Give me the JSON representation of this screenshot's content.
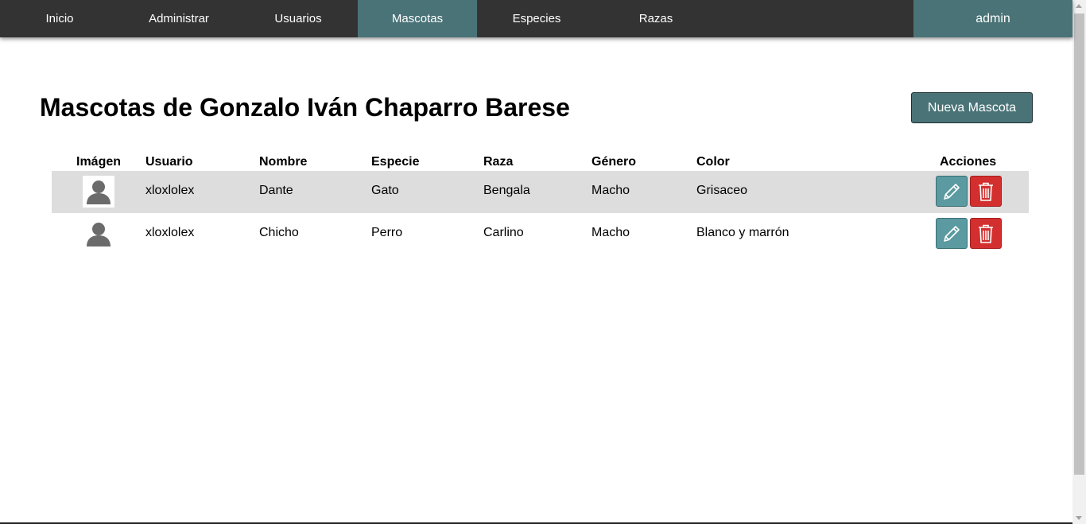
{
  "nav": {
    "items": [
      {
        "label": "Inicio",
        "active": false
      },
      {
        "label": "Administrar",
        "active": false
      },
      {
        "label": "Usuarios",
        "active": false
      },
      {
        "label": "Mascotas",
        "active": true
      },
      {
        "label": "Especies",
        "active": false
      },
      {
        "label": "Razas",
        "active": false
      }
    ],
    "user": "admin"
  },
  "page": {
    "title": "Mascotas de Gonzalo Iván Chaparro Barese",
    "new_button": "Nueva Mascota"
  },
  "table": {
    "headers": [
      "Imágen",
      "Usuario",
      "Nombre",
      "Especie",
      "Raza",
      "Género",
      "Color",
      "Acciones"
    ],
    "rows": [
      {
        "image": "user-avatar-icon",
        "usuario": "xloxlolex",
        "nombre": "Dante",
        "especie": "Gato",
        "raza": "Bengala",
        "genero": "Macho",
        "color": "Grisaceo"
      },
      {
        "image": "user-avatar-icon",
        "usuario": "xloxlolex",
        "nombre": "Chicho",
        "especie": "Perro",
        "raza": "Carlino",
        "genero": "Macho",
        "color": "Blanco y marrón"
      }
    ]
  },
  "colors": {
    "navbar": "#333333",
    "accent": "#4a7377",
    "edit": "#5a9aa0",
    "delete": "#d32f2f",
    "row_stripe": "#dddddd"
  },
  "icons": {
    "edit": "pencil-icon",
    "delete": "trash-icon",
    "avatar": "user-avatar-icon"
  }
}
